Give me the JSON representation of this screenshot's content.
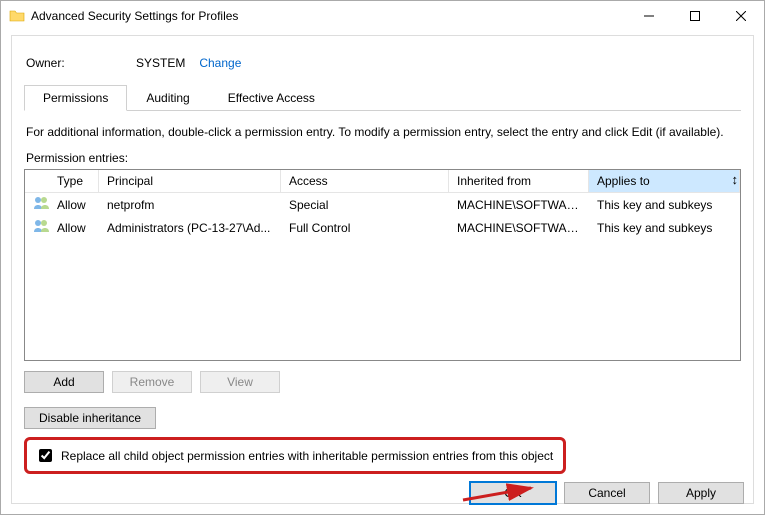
{
  "title": "Advanced Security Settings for Profiles",
  "owner": {
    "label": "Owner:",
    "value": "SYSTEM",
    "change": "Change"
  },
  "tabs": {
    "perm": "Permissions",
    "audit": "Auditing",
    "eff": "Effective Access"
  },
  "info": "For additional information, double-click a permission entry. To modify a permission entry, select the entry and click Edit (if available).",
  "entries_label": "Permission entries:",
  "columns": {
    "type": "Type",
    "principal": "Principal",
    "access": "Access",
    "inherited": "Inherited from",
    "applies": "Applies to"
  },
  "rows": [
    {
      "type": "Allow",
      "principal": "netprofm",
      "access": "Special",
      "inherited": "MACHINE\\SOFTWARE...",
      "applies": "This key and subkeys"
    },
    {
      "type": "Allow",
      "principal": "Administrators (PC-13-27\\Ad...",
      "access": "Full Control",
      "inherited": "MACHINE\\SOFTWARE...",
      "applies": "This key and subkeys"
    }
  ],
  "buttons": {
    "add": "Add",
    "remove": "Remove",
    "view": "View",
    "disable": "Disable inheritance",
    "ok": "OK",
    "cancel": "Cancel",
    "apply": "Apply"
  },
  "checkbox": "Replace all child object permission entries with inheritable permission entries from this object",
  "accent_red": "#cc1f1f",
  "link_blue": "#0066CC"
}
